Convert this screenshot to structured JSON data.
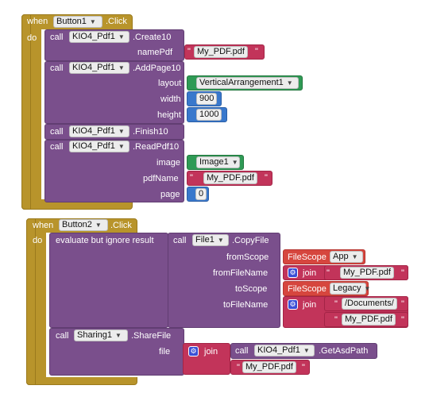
{
  "block1": {
    "when": "when",
    "component": "Button1",
    "event": ".Click",
    "do": "do",
    "create": {
      "call": "call",
      "component": "KIO4_Pdf1",
      "method": ".Create10",
      "param": "namePdf",
      "value": "My_PDF.pdf"
    },
    "addpage": {
      "call": "call",
      "component": "KIO4_Pdf1",
      "method": ".AddPage10",
      "layout_label": "layout",
      "layout_value": "VerticalArrangement1",
      "width_label": "width",
      "width_value": "900",
      "height_label": "height",
      "height_value": "1000"
    },
    "finish": {
      "call": "call",
      "component": "KIO4_Pdf1",
      "method": ".Finish10"
    },
    "readpdf": {
      "call": "call",
      "component": "KIO4_Pdf1",
      "method": ".ReadPdf10",
      "image_label": "image",
      "image_value": "Image1",
      "pdfname_label": "pdfName",
      "pdfname_value": "My_PDF.pdf",
      "page_label": "page",
      "page_value": "0"
    }
  },
  "block2": {
    "when": "when",
    "component": "Button2",
    "event": ".Click",
    "do": "do",
    "evaluate": "evaluate but ignore result",
    "copyfile": {
      "call": "call",
      "component": "File1",
      "method": ".CopyFile",
      "fromscope_label": "fromScope",
      "fromscope_kw": "FileScope",
      "fromscope_value": "App",
      "fromfilename_label": "fromFileName",
      "join1": "join",
      "join1_value": "My_PDF.pdf",
      "toscope_label": "toScope",
      "toscope_kw": "FileScope",
      "toscope_value": "Legacy",
      "tofilename_label": "toFileName",
      "join2": "join",
      "join2_value1": "/Documents/",
      "join2_value2": "My_PDF.pdf"
    },
    "share": {
      "call": "call",
      "component": "Sharing1",
      "method": ".ShareFile",
      "file_label": "file",
      "join": "join",
      "inner_call": "call",
      "inner_component": "KIO4_Pdf1",
      "inner_method": ".GetAsdPath",
      "value": "My_PDF.pdf"
    }
  },
  "icons": {
    "dropdown": "chevron-down-icon",
    "gear": "gear-icon"
  },
  "colors": {
    "event": "#b8942b",
    "call": "#7a4f8c",
    "text": "#c2345a",
    "component": "#2f9a55",
    "number": "#3978cc",
    "scope": "#d6463e"
  }
}
